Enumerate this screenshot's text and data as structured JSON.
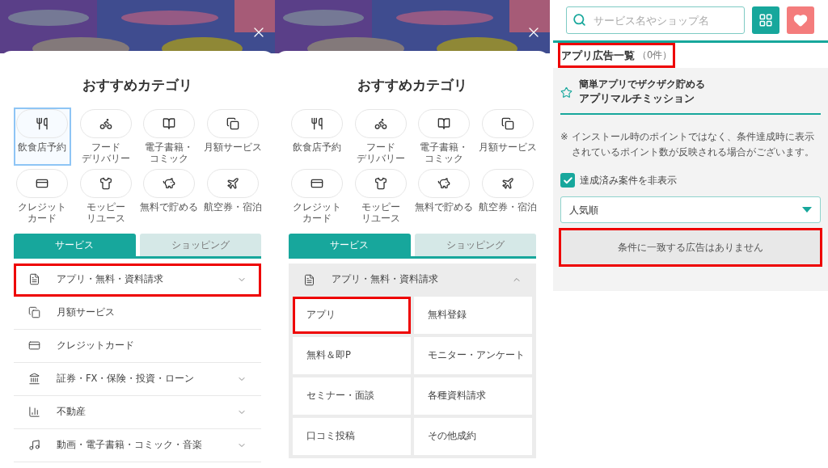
{
  "panels": [
    {
      "kind": "category_menu",
      "title": "おすすめカテゴリ",
      "chips": [
        {
          "lines": [
            "飲食店予約"
          ],
          "selected": true
        },
        {
          "lines": [
            "フード",
            "デリバリー"
          ],
          "selected": false
        },
        {
          "lines": [
            "電子書籍・",
            "コミック"
          ],
          "selected": false
        },
        {
          "lines": [
            "月額サービス"
          ],
          "selected": false
        },
        {
          "lines": [
            "クレジット",
            "カード"
          ],
          "selected": false
        },
        {
          "lines": [
            "モッピー",
            "リユース"
          ],
          "selected": false
        },
        {
          "lines": [
            "無料で貯める"
          ],
          "selected": false
        },
        {
          "lines": [
            "航空券・宿泊"
          ],
          "selected": false
        }
      ],
      "tabs": [
        {
          "label": "サービス",
          "selected": true
        },
        {
          "label": "ショッピング",
          "selected": false
        }
      ],
      "menu": [
        {
          "label": "アプリ・無料・資料請求",
          "expandable": true,
          "expanded": false,
          "highlighted": true
        },
        {
          "label": "月額サービス",
          "expandable": false,
          "expanded": false,
          "highlighted": false
        },
        {
          "label": "クレジットカード",
          "expandable": false,
          "expanded": false,
          "highlighted": false
        },
        {
          "label": "証券・FX・保険・投資・ローン",
          "expandable": true,
          "expanded": false,
          "highlighted": false
        },
        {
          "label": "不動産",
          "expandable": true,
          "expanded": false,
          "highlighted": false
        },
        {
          "label": "動画・電子書籍・コミック・音楽",
          "expandable": true,
          "expanded": false,
          "highlighted": false
        }
      ]
    },
    {
      "kind": "category_menu",
      "title": "おすすめカテゴリ",
      "chips": [
        {
          "lines": [
            "飲食店予約"
          ],
          "selected": false
        },
        {
          "lines": [
            "フード",
            "デリバリー"
          ],
          "selected": false
        },
        {
          "lines": [
            "電子書籍・",
            "コミック"
          ],
          "selected": false
        },
        {
          "lines": [
            "月額サービス"
          ],
          "selected": false
        },
        {
          "lines": [
            "クレジット",
            "カード"
          ],
          "selected": false
        },
        {
          "lines": [
            "モッピー",
            "リユース"
          ],
          "selected": false
        },
        {
          "lines": [
            "無料で貯める"
          ],
          "selected": false
        },
        {
          "lines": [
            "航空券・宿泊"
          ],
          "selected": false
        }
      ],
      "tabs": [
        {
          "label": "サービス",
          "selected": true
        },
        {
          "label": "ショッピング",
          "selected": false
        }
      ],
      "menu": [
        {
          "label": "アプリ・無料・資料請求",
          "expandable": true,
          "expanded": true,
          "highlighted": false,
          "children": [
            {
              "label": "アプリ",
              "highlighted": true
            },
            {
              "label": "無料登録",
              "highlighted": false
            },
            {
              "label": "無料＆即P",
              "highlighted": false
            },
            {
              "label": "モニター・アンケート",
              "highlighted": false
            },
            {
              "label": "セミナー・面談",
              "highlighted": false
            },
            {
              "label": "各種資料請求",
              "highlighted": false
            },
            {
              "label": "口コミ投稿",
              "highlighted": false
            },
            {
              "label": "その他成約",
              "highlighted": false
            }
          ]
        }
      ]
    },
    {
      "kind": "ad_list",
      "search": {
        "placeholder": "サービス名やショップ名"
      },
      "heading": {
        "title": "アプリ広告一覧",
        "count": "（0件）",
        "highlighted": true
      },
      "section": {
        "subtitle": "簡単アプリでザクザク貯める",
        "title": "アプリマルチミッション"
      },
      "note": {
        "mark": "※",
        "text": "インストール時のポイントではなく、条件達成時に表示されているポイント数が反映される場合がございます。"
      },
      "filter": {
        "label": "達成済み案件を非表示",
        "checked": true
      },
      "sort": {
        "value": "人気順"
      },
      "empty": {
        "text": "条件に一致する広告はありません",
        "highlighted": true
      }
    }
  ]
}
